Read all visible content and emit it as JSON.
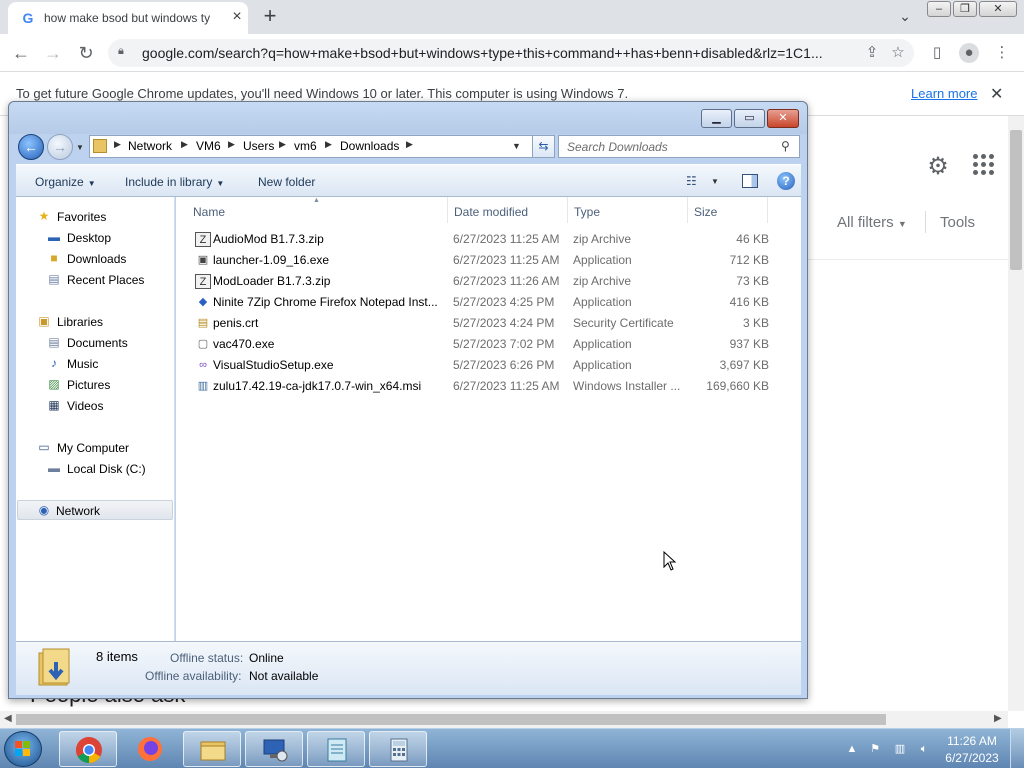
{
  "chrome": {
    "tab_title": "how make bsod but windows ty",
    "tab_favicon": "G",
    "new_tab": "+",
    "url": "google.com/search?q=how+make+bsod+but+windows+type+this+command++has+benn+disabled&rlz=1C1...",
    "infobar_message": "To get future Google Chrome updates, you'll need Windows 10 or later. This computer is using Windows 7.",
    "infobar_link": "Learn more"
  },
  "google": {
    "all_filters": "All filters",
    "tools": "Tools",
    "people_also_ask": "People also ask"
  },
  "explorer": {
    "breadcrumbs": [
      "Network",
      "VM6",
      "Users",
      "vm6",
      "Downloads"
    ],
    "search_placeholder": "Search Downloads",
    "commands": {
      "organize": "Organize",
      "include_in_library": "Include in library",
      "new_folder": "New folder"
    },
    "nav": {
      "favorites": "Favorites",
      "desktop": "Desktop",
      "downloads": "Downloads",
      "recent_places": "Recent Places",
      "libraries": "Libraries",
      "documents": "Documents",
      "music": "Music",
      "pictures": "Pictures",
      "videos": "Videos",
      "my_computer": "My Computer",
      "local_disk": "Local Disk (C:)",
      "network": "Network"
    },
    "columns": {
      "name": "Name",
      "date_modified": "Date modified",
      "type": "Type",
      "size": "Size"
    },
    "files": [
      {
        "name": "AudioMod B1.7.3.zip",
        "date": "6/27/2023 11:25 AM",
        "type": "zip Archive",
        "size": "46 KB",
        "icon": "zip-icon"
      },
      {
        "name": "launcher-1.09_16.exe",
        "date": "6/27/2023 11:25 AM",
        "type": "Application",
        "size": "712 KB",
        "icon": "app-icon"
      },
      {
        "name": "ModLoader B1.7.3.zip",
        "date": "6/27/2023 11:26 AM",
        "type": "zip Archive",
        "size": "73 KB",
        "icon": "zip-icon"
      },
      {
        "name": "Ninite 7Zip Chrome Firefox Notepad Inst...",
        "date": "5/27/2023 4:25 PM",
        "type": "Application",
        "size": "416 KB",
        "icon": "ninite-icon"
      },
      {
        "name": "penis.crt",
        "date": "5/27/2023 4:24 PM",
        "type": "Security Certificate",
        "size": "3 KB",
        "icon": "certificate-icon"
      },
      {
        "name": "vac470.exe",
        "date": "5/27/2023 7:02 PM",
        "type": "Application",
        "size": "937 KB",
        "icon": "app-icon"
      },
      {
        "name": "VisualStudioSetup.exe",
        "date": "5/27/2023 6:26 PM",
        "type": "Application",
        "size": "3,697 KB",
        "icon": "visual-studio-icon"
      },
      {
        "name": "zulu17.42.19-ca-jdk17.0.7-win_x64.msi",
        "date": "6/27/2023 11:25 AM",
        "type": "Windows Installer ...",
        "size": "169,660 KB",
        "icon": "installer-icon"
      }
    ],
    "details": {
      "item_count": "8 items",
      "offline_status_label": "Offline status:",
      "offline_status_value": "Online",
      "offline_availability_label": "Offline availability:",
      "offline_availability_value": "Not available"
    }
  },
  "taskbar": {
    "time": "11:26 AM",
    "date": "6/27/2023"
  },
  "colors": {
    "chrome_tabbar": "#dee1e6",
    "link_blue": "#1a73e8",
    "explorer_frame": "#bcd2ee",
    "taskbar": "#5f86b2"
  }
}
